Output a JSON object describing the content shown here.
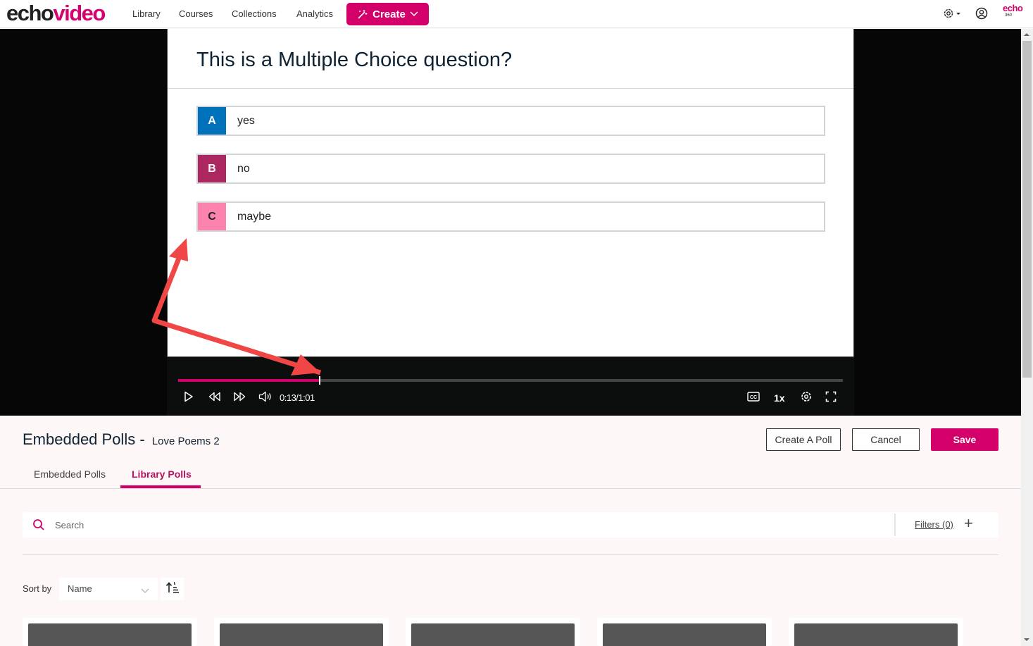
{
  "nav": {
    "logo_part1": "echo",
    "logo_part2": "video",
    "links": [
      "Library",
      "Courses",
      "Collections",
      "Analytics"
    ],
    "create_label": "Create",
    "settings_icon": "gear-icon",
    "user_icon": "user-circle-icon",
    "brand_badge_top": "echo",
    "brand_badge_bottom": "360"
  },
  "player": {
    "question": "This is a Multiple Choice question?",
    "options": [
      {
        "letter": "A",
        "text": "yes",
        "color": "#0072bc"
      },
      {
        "letter": "B",
        "text": "no",
        "color": "#ac2660"
      },
      {
        "letter": "C",
        "text": "maybe",
        "color": "#fb83ad"
      }
    ],
    "progress_fraction": 0.213,
    "time_display": "0:13/1:01",
    "speed_label": "1x",
    "cc_label": "CC"
  },
  "panel": {
    "title": "Embedded Polls -",
    "subtitle": "Love Poems 2",
    "create_poll_label": "Create A Poll",
    "cancel_label": "Cancel",
    "save_label": "Save",
    "tabs": [
      {
        "label": "Embedded Polls",
        "active": false
      },
      {
        "label": "Library Polls",
        "active": true
      }
    ],
    "search_placeholder": "Search",
    "filters_label": "Filters (0)",
    "filters_plus": "+",
    "sort_by_label": "Sort by",
    "sort_value": "Name",
    "cards_visible": 5
  },
  "colors": {
    "accent": "#d4006a",
    "player_bg": "#050605"
  }
}
